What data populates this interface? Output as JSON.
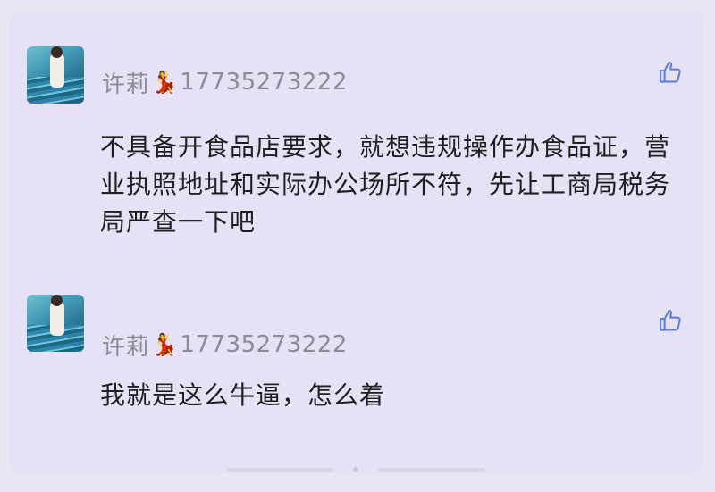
{
  "comments": [
    {
      "username": "许莉",
      "phone": "17735273222",
      "emoji_icon": "dancer-emoji",
      "text": "不具备开食品店要求，就想违规操作办食品证，营业执照地址和实际办公场所不符，先让工商局税务局严查一下吧"
    },
    {
      "username": "许莉",
      "phone": "17735273222",
      "emoji_icon": "dancer-emoji",
      "text": "我就是这么牛逼，怎么着"
    }
  ],
  "icons": {
    "like": "thumbs-up-icon",
    "avatar": "user-avatar"
  },
  "colors": {
    "background": "#e6e1f4",
    "username": "#8b8b96",
    "text": "#1f1f22",
    "icon": "#5b7fd1"
  }
}
